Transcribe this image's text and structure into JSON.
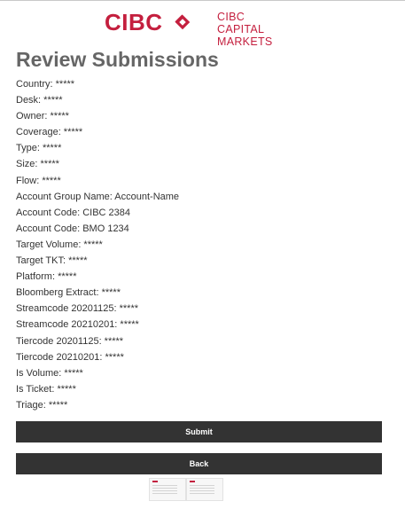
{
  "header": {
    "logo_text": "CIBC",
    "tagline_line1": "CIBC CAPITAL",
    "tagline_line2": "MARKETS",
    "brand_color": "#c41f3e"
  },
  "page": {
    "title": "Review Submissions"
  },
  "fields": [
    "Country: *****",
    "Desk: *****",
    "Owner: *****",
    "Coverage: *****",
    "Type: *****",
    "Size: *****",
    "Flow: *****",
    "Account Group Name: Account-Name",
    "Account Code: CIBC 2384",
    "Account Code: BMO 1234",
    "Target Volume: *****",
    "Target TKT: *****",
    "Platform: *****",
    "Bloomberg Extract: *****",
    "Streamcode 20201125: *****",
    "Streamcode 20210201: *****",
    "Tiercode 20201125: *****",
    "Tiercode 20210201: *****",
    "Is Volume: *****",
    "Is Ticket: *****",
    "Triage: *****"
  ],
  "actions": {
    "submit_label": "Submit",
    "back_label": "Back",
    "button_color": "#333333"
  }
}
